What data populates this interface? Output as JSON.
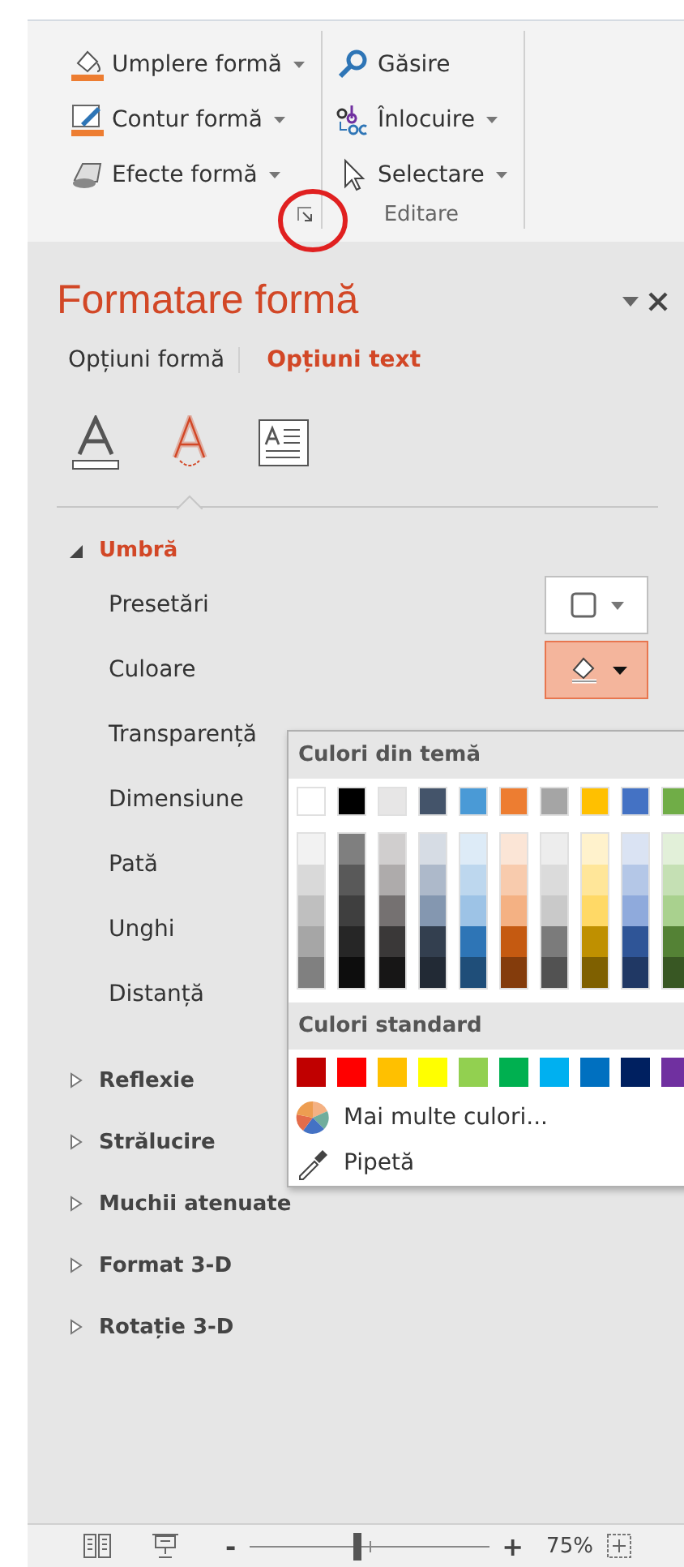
{
  "ribbon": {
    "groups": [
      {
        "launcher": true,
        "items": [
          {
            "kind": "fill",
            "label": "Umplere formă",
            "dropdown": true
          },
          {
            "kind": "outline",
            "label": "Contur formă",
            "dropdown": true
          },
          {
            "kind": "effects",
            "label": "Efecte formă",
            "dropdown": true
          }
        ]
      },
      {
        "label": "Editare",
        "items": [
          {
            "kind": "find",
            "label": "Găsire",
            "dropdown": false
          },
          {
            "kind": "replace",
            "label": "Înlocuire",
            "dropdown": true
          },
          {
            "kind": "select",
            "label": "Selectare",
            "dropdown": true
          }
        ]
      }
    ]
  },
  "pane": {
    "title": "Formatare formă",
    "tabs": [
      {
        "label": "Opțiuni formă",
        "selected": false
      },
      {
        "label": "Opțiuni text",
        "selected": true
      }
    ],
    "icon_tabs": [
      {
        "kind": "fill",
        "selected": false
      },
      {
        "kind": "effects",
        "selected": true
      },
      {
        "kind": "textbox",
        "selected": false
      }
    ],
    "sections": [
      {
        "label": "Umbră",
        "expanded": true,
        "properties": [
          {
            "label": "Presetări",
            "kind": "preset"
          },
          {
            "label": "Culoare",
            "kind": "color"
          },
          {
            "label": "Transparență",
            "kind": "plain"
          },
          {
            "label": "Dimensiune",
            "kind": "plain"
          },
          {
            "label": "Pată",
            "kind": "plain"
          },
          {
            "label": "Unghi",
            "kind": "plain"
          },
          {
            "label": "Distanță",
            "kind": "plain"
          }
        ]
      },
      {
        "label": "Reflexie",
        "expanded": false
      },
      {
        "label": "Strălucire",
        "expanded": false
      },
      {
        "label": "Muchii atenuate",
        "expanded": false
      },
      {
        "label": "Format 3-D",
        "expanded": false
      },
      {
        "label": "Rotație 3-D",
        "expanded": false
      }
    ]
  },
  "color_popup": {
    "theme_heading": "Culori din temă",
    "theme_colors": [
      {
        "color": "#ffffff",
        "shades": [
          {
            "color": "#f2f2f2"
          },
          {
            "color": "#d9d9d9"
          },
          {
            "color": "#bfbfbf"
          },
          {
            "color": "#a6a6a6"
          },
          {
            "color": "#808080"
          }
        ]
      },
      {
        "color": "#000000",
        "shades": [
          {
            "color": "#7f7f7f"
          },
          {
            "color": "#595959"
          },
          {
            "color": "#3f3f3f"
          },
          {
            "color": "#262626"
          },
          {
            "color": "#0d0d0d"
          }
        ]
      },
      {
        "color": "#e7e6e6",
        "shades": [
          {
            "color": "#d0cece"
          },
          {
            "color": "#aeabab"
          },
          {
            "color": "#757171"
          },
          {
            "color": "#3a3838"
          },
          {
            "color": "#171616"
          }
        ]
      },
      {
        "color": "#44546a",
        "shades": [
          {
            "color": "#d6dce4"
          },
          {
            "color": "#adb9ca"
          },
          {
            "color": "#8497b0"
          },
          {
            "color": "#333f4f"
          },
          {
            "color": "#222a35"
          }
        ]
      },
      {
        "color": "#4a9ad6",
        "shades": [
          {
            "color": "#ddebf7"
          },
          {
            "color": "#bdd7ee"
          },
          {
            "color": "#9dc3e6"
          },
          {
            "color": "#2e75b6"
          },
          {
            "color": "#1f4e79"
          }
        ]
      },
      {
        "color": "#ed7d31",
        "shades": [
          {
            "color": "#fbe5d6"
          },
          {
            "color": "#f8cbad"
          },
          {
            "color": "#f4b183"
          },
          {
            "color": "#c55a11"
          },
          {
            "color": "#843c0c"
          }
        ]
      },
      {
        "color": "#a5a5a5",
        "shades": [
          {
            "color": "#ededed"
          },
          {
            "color": "#dbdbdb"
          },
          {
            "color": "#c9c9c9"
          },
          {
            "color": "#7b7b7b"
          },
          {
            "color": "#525252"
          }
        ]
      },
      {
        "color": "#ffc000",
        "shades": [
          {
            "color": "#fff2cc"
          },
          {
            "color": "#ffe699"
          },
          {
            "color": "#ffd966"
          },
          {
            "color": "#bf9000"
          },
          {
            "color": "#7f6000"
          }
        ]
      },
      {
        "color": "#4472c4",
        "shades": [
          {
            "color": "#dae3f3"
          },
          {
            "color": "#b4c7e7"
          },
          {
            "color": "#8faadc"
          },
          {
            "color": "#2f5597"
          },
          {
            "color": "#203864"
          }
        ]
      },
      {
        "color": "#70ad47",
        "shades": [
          {
            "color": "#e2f0d9"
          },
          {
            "color": "#c5e0b4"
          },
          {
            "color": "#a9d18e"
          },
          {
            "color": "#548235"
          },
          {
            "color": "#385723"
          }
        ]
      }
    ],
    "standard_heading": "Culori standard",
    "standard_colors": [
      {
        "color": "#c00000"
      },
      {
        "color": "#ff0000"
      },
      {
        "color": "#ffc000"
      },
      {
        "color": "#ffff00"
      },
      {
        "color": "#92d050"
      },
      {
        "color": "#00b050"
      },
      {
        "color": "#00b0f0"
      },
      {
        "color": "#0070c0"
      },
      {
        "color": "#002060"
      },
      {
        "color": "#7030a0"
      }
    ],
    "actions": [
      {
        "kind": "more",
        "label": "Mai multe culori..."
      },
      {
        "kind": "eyedropper",
        "label": "Pipetă"
      }
    ]
  },
  "status_bar": {
    "zoom_out": "-",
    "zoom_in": "+",
    "zoom": {
      "level": 0.45
    },
    "zoom_label": "75%"
  }
}
